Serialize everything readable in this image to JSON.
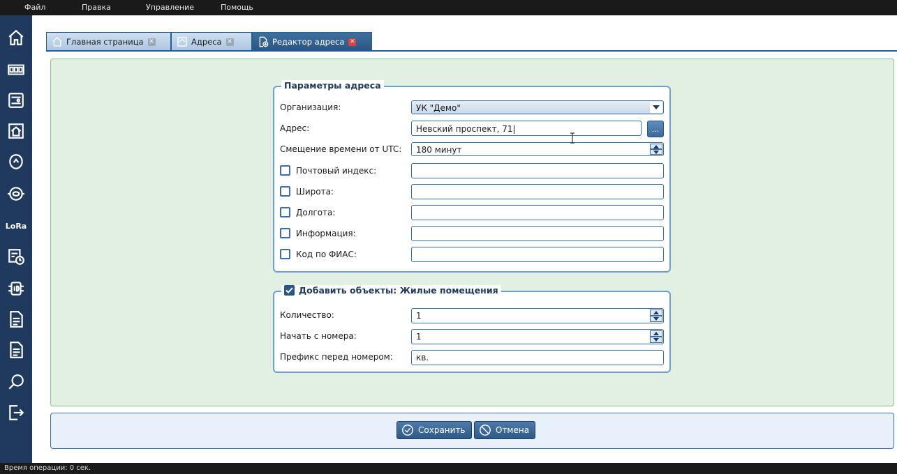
{
  "menu": {
    "file": "Файл",
    "edit": "Правка",
    "manage": "Управление",
    "help": "Помощь"
  },
  "sidebar_icons": [
    "home-icon",
    "meter-icon",
    "device-icon",
    "building-icon",
    "sensor-icon",
    "gauge-icon",
    "lora-icon",
    "schedule-icon",
    "id-icon",
    "document-icon",
    "report-icon",
    "search-icon",
    "exit-icon"
  ],
  "sidebar": {
    "lora_label": "LoRa"
  },
  "tabs": [
    {
      "label": "Главная страница",
      "icon": "home-icon"
    },
    {
      "label": "Адреса",
      "icon": "building-icon"
    },
    {
      "label": "Редактор адреса",
      "icon": "add-document-icon"
    }
  ],
  "address_params": {
    "legend": "Параметры адреса",
    "organization": {
      "label": "Организация:",
      "value": "УК \"Демо\""
    },
    "address": {
      "label": "Адрес:",
      "value": "Невский проспект, 71",
      "browse": "..."
    },
    "utc_offset": {
      "label": "Смещение времени от UTC:",
      "value": "180 минут"
    },
    "optional_fields": [
      {
        "label": "Почтовый индекс:",
        "checked": false,
        "value": ""
      },
      {
        "label": "Широта:",
        "checked": false,
        "value": ""
      },
      {
        "label": "Долгота:",
        "checked": false,
        "value": ""
      },
      {
        "label": "Информация:",
        "checked": false,
        "value": ""
      },
      {
        "label": "Код по ФИАС:",
        "checked": false,
        "value": ""
      }
    ]
  },
  "add_objects": {
    "legend": "Добавить объекты: Жилые помещения",
    "checked": true,
    "count": {
      "label": "Количество:",
      "value": "1"
    },
    "start_number": {
      "label": "Начать с номера:",
      "value": "1"
    },
    "prefix": {
      "label": "Префикс перед номером:",
      "value": "кв."
    }
  },
  "buttons": {
    "save": "Сохранить",
    "cancel": "Отмена"
  },
  "status": {
    "text": "Время операции: 0 сек."
  },
  "colors": {
    "sidebar": "#1f3a5c",
    "accent": "#2a5685",
    "workarea": "#e2f0e2"
  }
}
